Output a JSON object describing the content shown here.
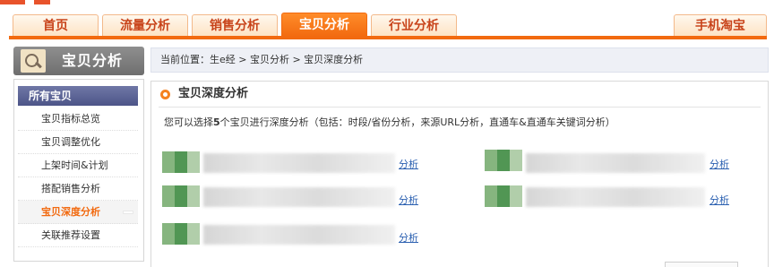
{
  "nav": {
    "tabs": [
      {
        "label": "首页"
      },
      {
        "label": "流量分析"
      },
      {
        "label": "销售分析"
      },
      {
        "label": "宝贝分析",
        "active": true
      },
      {
        "label": "行业分析"
      }
    ],
    "right_tab": "手机淘宝"
  },
  "sidebar": {
    "header": "宝贝分析",
    "title": "所有宝贝",
    "items": [
      {
        "label": "宝贝指标总览"
      },
      {
        "label": "宝贝调整优化"
      },
      {
        "label": "上架时间&计划"
      },
      {
        "label": "搭配销售分析"
      },
      {
        "label": "宝贝深度分析",
        "active": true
      },
      {
        "label": "关联推荐设置"
      }
    ]
  },
  "breadcrumb": "当前位置：生e经 > 宝贝分析 > 宝贝深度分析",
  "main": {
    "section_title": "宝贝深度分析",
    "desc_prefix": "您可以选择",
    "desc_count": "5",
    "desc_suffix": "个宝贝进行深度分析（包括：时段/省份分析，来源URL分析，直通车&直通车关键词分析）",
    "analyze_label": "分析",
    "products": [
      {
        "link": "分析"
      },
      {
        "link": "分析"
      },
      {
        "link": "分析"
      },
      {
        "link": "分析"
      },
      {
        "link": "分析"
      }
    ]
  },
  "colors": {
    "accent": "#f26a10",
    "sidebar_title": "#4d5588",
    "link": "#2a5fb0"
  }
}
